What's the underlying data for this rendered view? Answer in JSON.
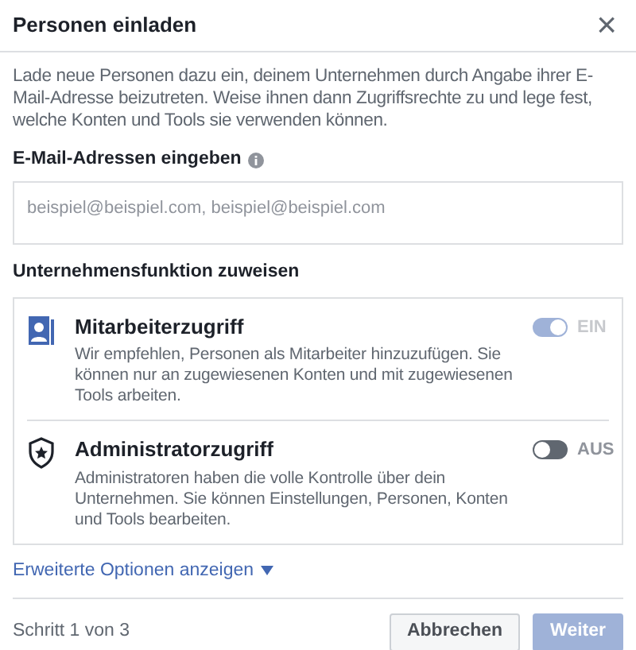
{
  "window": {
    "title": "Personen einladen",
    "close": "×"
  },
  "description": "Lade neue Personen dazu ein, deinem Unternehmen durch Angabe ihrer E-Mail-Adresse beizutreten. Weise ihnen dann Zugriffsrechte zu und lege fest, welche Konten und Tools sie verwenden können.",
  "email": {
    "label": "E-Mail-Adressen eingeben",
    "placeholder": "beispiel@beispiel.com, beispiel@beispiel.com"
  },
  "roles": {
    "label": "Unternehmensfunktion zuweisen",
    "items": [
      {
        "kind": "employee",
        "title": "Mitarbeiterzugriff",
        "text": "Wir empfehlen, Personen als Mitarbeiter hinzuzufügen. Sie können nur an zugewiesenen Konten und mit zugewiesenen Tools arbeiten.",
        "on": true,
        "disabled": true,
        "state_label": "EIN"
      },
      {
        "kind": "admin",
        "title": "Administratorzugriff",
        "text": "Administratoren haben die volle Kontrolle über dein Unternehmen. Sie können Einstellungen, Personen, Konten und Tools bearbeiten.",
        "on": false,
        "disabled": false,
        "state_label": "AUS"
      }
    ]
  },
  "advanced_link": "Erweiterte Optionen anzeigen",
  "footer": {
    "step": "Schritt 1 von 3",
    "buttons": [
      {
        "kind": "secondary",
        "label": "Abbrechen",
        "disabled": false
      },
      {
        "kind": "primary",
        "label": "Weiter",
        "disabled": true
      }
    ]
  }
}
